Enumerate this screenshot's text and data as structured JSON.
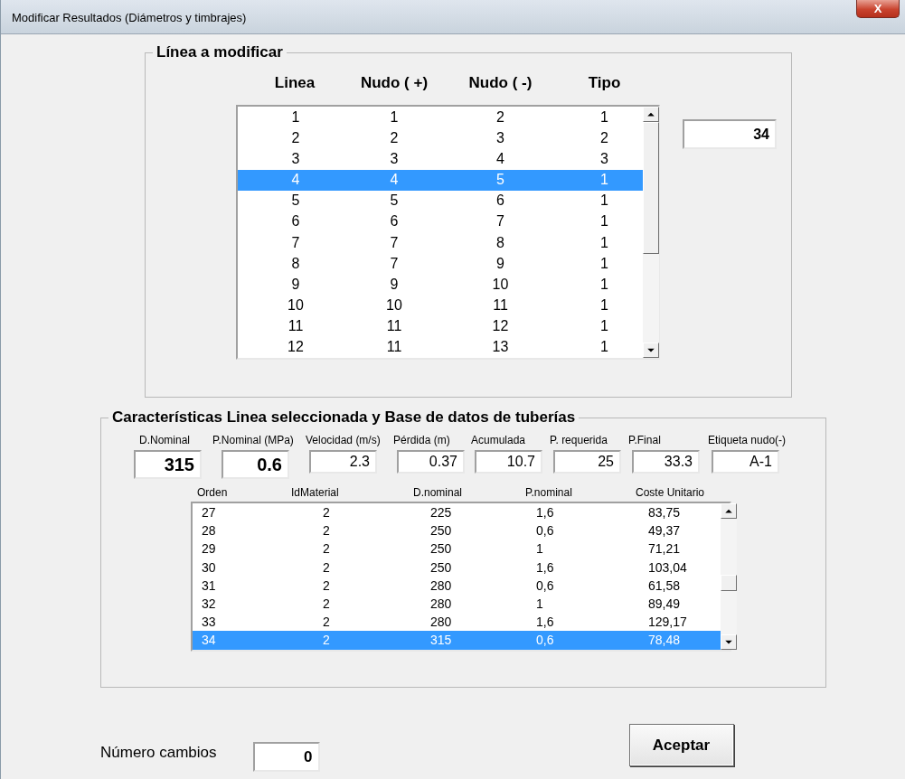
{
  "window": {
    "title": "Modificar Resultados (Diámetros y timbrajes)",
    "close": "X"
  },
  "linea_group": {
    "title": "Línea a modificar",
    "columns": [
      "Linea",
      "Nudo  ( +)",
      "Nudo ( -)",
      "Tipo"
    ],
    "rows": [
      {
        "cells": [
          "1",
          "1",
          "2",
          "1"
        ],
        "selected": false
      },
      {
        "cells": [
          "2",
          "2",
          "3",
          "2"
        ],
        "selected": false
      },
      {
        "cells": [
          "3",
          "3",
          "4",
          "3"
        ],
        "selected": false
      },
      {
        "cells": [
          "4",
          "4",
          "5",
          "1"
        ],
        "selected": true
      },
      {
        "cells": [
          "5",
          "5",
          "6",
          "1"
        ],
        "selected": false
      },
      {
        "cells": [
          "6",
          "6",
          "7",
          "1"
        ],
        "selected": false
      },
      {
        "cells": [
          "7",
          "7",
          "8",
          "1"
        ],
        "selected": false
      },
      {
        "cells": [
          "8",
          "7",
          "9",
          "1"
        ],
        "selected": false
      },
      {
        "cells": [
          "9",
          "9",
          "10",
          "1"
        ],
        "selected": false
      },
      {
        "cells": [
          "10",
          "10",
          "11",
          "1"
        ],
        "selected": false
      },
      {
        "cells": [
          "11",
          "11",
          "12",
          "1"
        ],
        "selected": false
      },
      {
        "cells": [
          "12",
          "11",
          "13",
          "1"
        ],
        "selected": false
      }
    ],
    "side_value": "34"
  },
  "caracteristicas_group": {
    "title": "Características Linea seleccionada y Base de datos de tuberías",
    "fields": [
      {
        "label": "D.Nominal",
        "value": "315",
        "kind": "large"
      },
      {
        "label": "P.Nominal (MPa)",
        "value": "0.6",
        "kind": "large"
      },
      {
        "label": "Velocidad (m/s)",
        "value": "2.3",
        "kind": "small"
      },
      {
        "label": "Pérdida (m)",
        "value": "0.37",
        "kind": "small"
      },
      {
        "label": "Acumulada",
        "value": "10.7",
        "kind": "small"
      },
      {
        "label": "P. requerida",
        "value": "25",
        "kind": "small"
      },
      {
        "label": "P.Final",
        "value": "33.3",
        "kind": "small"
      },
      {
        "label": "Etiqueta nudo(-)",
        "value": "A-1",
        "kind": "small"
      }
    ],
    "columns": [
      "Orden",
      "IdMaterial",
      "D.nominal",
      "P.nominal",
      "Coste Unitario"
    ],
    "rows": [
      {
        "cells": [
          "27",
          "2",
          "225",
          "1,6",
          "83,75"
        ],
        "selected": false
      },
      {
        "cells": [
          "28",
          "2",
          "250",
          "0,6",
          "49,37"
        ],
        "selected": false
      },
      {
        "cells": [
          "29",
          "2",
          "250",
          "1",
          "71,21"
        ],
        "selected": false
      },
      {
        "cells": [
          "30",
          "2",
          "250",
          "1,6",
          "103,04"
        ],
        "selected": false
      },
      {
        "cells": [
          "31",
          "2",
          "280",
          "0,6",
          "61,58"
        ],
        "selected": false
      },
      {
        "cells": [
          "32",
          "2",
          "280",
          "1",
          "89,49"
        ],
        "selected": false
      },
      {
        "cells": [
          "33",
          "2",
          "280",
          "1,6",
          "129,17"
        ],
        "selected": false
      },
      {
        "cells": [
          "34",
          "2",
          "315",
          "0,6",
          "78,48"
        ],
        "selected": true
      }
    ]
  },
  "cambios": {
    "label": "Número cambios",
    "value": "0"
  },
  "buttons": [
    "Aceptar"
  ]
}
